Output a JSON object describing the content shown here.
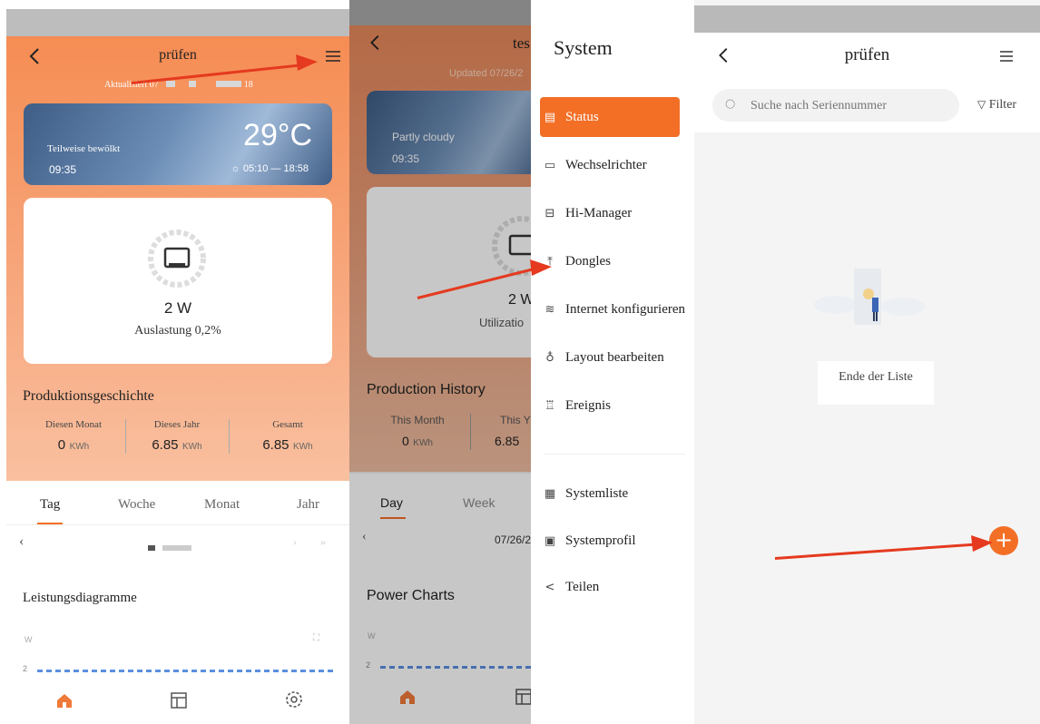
{
  "panel1": {
    "header": {
      "title": "prüfen",
      "back_icon": "chevron-left-icon",
      "menu_icon": "hamburger-icon"
    },
    "updated_text": "Aktualisiert 07",
    "updated_suffix": "18",
    "weather": {
      "condition": "Teilweise bewölkt",
      "time": "09:35",
      "temperature": "29°C",
      "sunrise": "05:10",
      "sunset": "18:58",
      "sun_range": "05:10 — 18:58"
    },
    "power": {
      "value": "2 W",
      "utilization": "Auslastung 0,2%"
    },
    "production": {
      "title": "Produktionsgeschichte",
      "columns": [
        {
          "label": "Diesen Monat",
          "value": "0",
          "unit": "KWh"
        },
        {
          "label": "Dieses Jahr",
          "value": "6.85",
          "unit": "KWh"
        },
        {
          "label": "Gesamt",
          "value": "6.85",
          "unit": "KWh"
        }
      ]
    },
    "tabs": [
      "Tag",
      "Woche",
      "Monat",
      "Jahr"
    ],
    "active_tab": "Tag",
    "date_nav": {
      "prev": "‹",
      "next": "›",
      "last": "»"
    },
    "chart_title": "Leistungsdiagramme",
    "chart_unit": "W",
    "chart_tick": "2",
    "bottom_nav": [
      "home-icon",
      "layout-icon",
      "gear-icon"
    ]
  },
  "panel2": {
    "header": {
      "title": "tes"
    },
    "updated_text": "Updated 07/26/2",
    "weather": {
      "condition": "Partly cloudy",
      "time": "09:35"
    },
    "power": {
      "value": "2 W",
      "utilization": "Utilizatio"
    },
    "production": {
      "title": "Production History",
      "columns": [
        {
          "label": "This Month",
          "value": "0",
          "unit": "KWh"
        },
        {
          "label": "This Y",
          "value": "6.85",
          "unit": ""
        }
      ]
    },
    "tabs": [
      "Day",
      "Week"
    ],
    "date_text": "07/26/2",
    "chart_title": "Power Charts",
    "chart_unit": "W",
    "chart_tick": "2"
  },
  "panel3": {
    "title": "System",
    "items": [
      {
        "label": "Status",
        "icon": "status-icon",
        "glyph": "▤",
        "active": true
      },
      {
        "label": "Wechselrichter",
        "icon": "inverter-icon",
        "glyph": "▭",
        "active": false
      },
      {
        "label": "Hi-Manager",
        "icon": "manager-icon",
        "glyph": "⊟",
        "active": false
      },
      {
        "label": "Dongles",
        "icon": "dongle-icon",
        "glyph": "⤒",
        "active": false
      },
      {
        "label": "Internet konfigurieren",
        "icon": "wifi-icon",
        "glyph": "≋",
        "active": false
      },
      {
        "label": "Layout bearbeiten",
        "icon": "layout-edit-icon",
        "glyph": "♁",
        "active": false
      },
      {
        "label": "Ereignis",
        "icon": "event-icon",
        "glyph": "♖",
        "active": false
      }
    ],
    "items2": [
      {
        "label": "Systemliste",
        "icon": "list-icon",
        "glyph": "▦"
      },
      {
        "label": "Systemprofil",
        "icon": "profile-icon",
        "glyph": "▣"
      },
      {
        "label": "Teilen",
        "icon": "share-icon",
        "glyph": "<"
      }
    ]
  },
  "panel4": {
    "header": {
      "title": "prüfen"
    },
    "search": {
      "placeholder": "Suche nach Seriennummer"
    },
    "filter_label": "Filter",
    "empty_text": "Ende der Liste",
    "add_button": "+"
  },
  "colors": {
    "accent": "#f36f26",
    "arrow": "#e53a1f"
  }
}
